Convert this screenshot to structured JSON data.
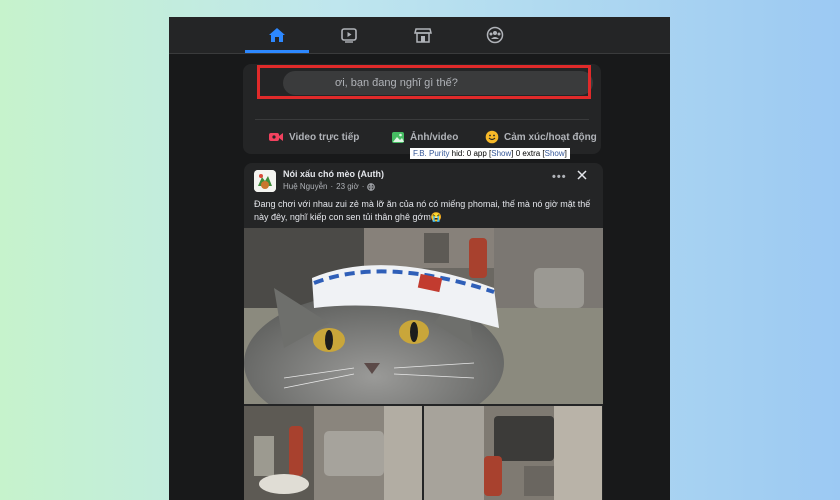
{
  "nav": {
    "tabs": [
      {
        "icon": "home-icon",
        "active": true
      },
      {
        "icon": "watch-video-icon",
        "active": false
      },
      {
        "icon": "marketplace-icon",
        "active": false
      },
      {
        "icon": "groups-icon",
        "active": false
      }
    ]
  },
  "composer": {
    "placeholder": "ơi, bạn đang nghĩ gì thế?",
    "actions": [
      {
        "label": "Video trực tiếp",
        "icon": "live-video-icon",
        "color": "#f3425f"
      },
      {
        "label": "Ảnh/video",
        "icon": "photo-video-icon",
        "color": "#45bd62"
      },
      {
        "label": "Cảm xúc/hoạt động",
        "icon": "feeling-emoji-icon",
        "color": "#f7b928"
      }
    ]
  },
  "purity": {
    "brand": "F.B. Purity",
    "hid": " hid:  0 app [",
    "show1": "Show",
    "mid": "]   0 extra [",
    "show2": "Show",
    "end": "]"
  },
  "post": {
    "group_name": "Nói xấu chó mèo (Auth)",
    "author": "Huệ Nguyễn",
    "time": "23 giờ",
    "text": "Đang chơi với nhau zui zẻ mà lỡ ăn của nó có miếng phomai, thế mà nó giờ mặt thế này đêy, nghĩ kiếp con sen tủi thân ghê gớm😭"
  },
  "colors": {
    "accent": "#2d88ff",
    "highlight": "#e02a2a",
    "background": "#18191a",
    "card": "#242526"
  }
}
